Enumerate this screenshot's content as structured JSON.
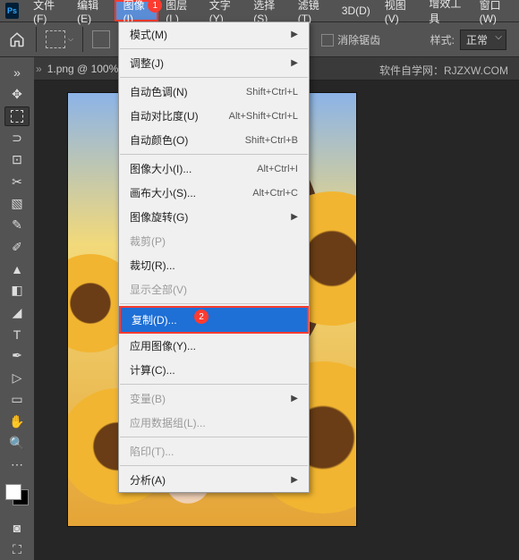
{
  "menu": {
    "items": [
      "文件(F)",
      "编辑(E)",
      "图像(I)",
      "图层(L)",
      "文字(Y)",
      "选择(S)",
      "滤镜(T)",
      "3D(D)",
      "视图(V)",
      "增效工具",
      "窗口(W)"
    ],
    "activeIndex": 2,
    "badge1": "1"
  },
  "toolbar": {
    "anti_alias": "消除锯齿",
    "style_label": "样式:",
    "style_value": "正常"
  },
  "tab": {
    "title": "1.png @ 100%"
  },
  "watermark": "软件自学网：RJZXW.COM",
  "dropdown": {
    "mode": "模式(M)",
    "adjust": "调整(J)",
    "auto_tone": {
      "label": "自动色调(N)",
      "shortcut": "Shift+Ctrl+L"
    },
    "auto_contrast": {
      "label": "自动对比度(U)",
      "shortcut": "Alt+Shift+Ctrl+L"
    },
    "auto_color": {
      "label": "自动颜色(O)",
      "shortcut": "Shift+Ctrl+B"
    },
    "image_size": {
      "label": "图像大小(I)...",
      "shortcut": "Alt+Ctrl+I"
    },
    "canvas_size": {
      "label": "画布大小(S)...",
      "shortcut": "Alt+Ctrl+C"
    },
    "rotation": "图像旋转(G)",
    "crop": "裁剪(P)",
    "trim": "裁切(R)...",
    "reveal_all": "显示全部(V)",
    "duplicate": "复制(D)...",
    "badge2": "2",
    "apply_image": "应用图像(Y)...",
    "calculations": "计算(C)...",
    "variables": "变量(B)",
    "apply_data": "应用数据组(L)...",
    "trap": "陷印(T)...",
    "analysis": "分析(A)"
  }
}
